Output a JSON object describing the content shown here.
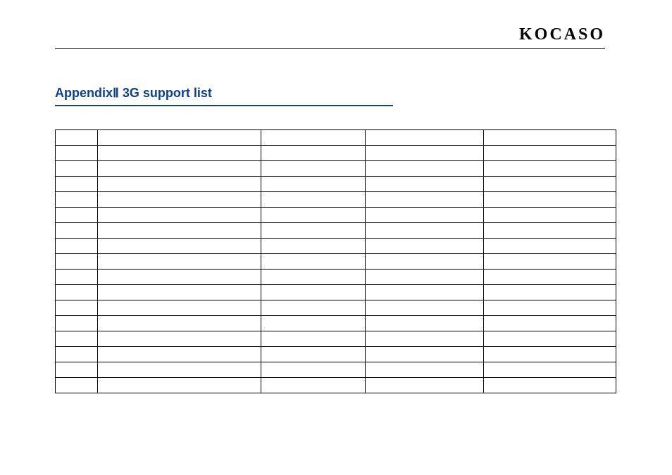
{
  "brand": "KOCASO",
  "title": "AppendixⅡ  3G support list",
  "table": {
    "rows": 17,
    "columns": 5,
    "cells": [
      [
        "",
        "",
        "",
        "",
        ""
      ],
      [
        "",
        "",
        "",
        "",
        ""
      ],
      [
        "",
        "",
        "",
        "",
        ""
      ],
      [
        "",
        "",
        "",
        "",
        ""
      ],
      [
        "",
        "",
        "",
        "",
        ""
      ],
      [
        "",
        "",
        "",
        "",
        ""
      ],
      [
        "",
        "",
        "",
        "",
        ""
      ],
      [
        "",
        "",
        "",
        "",
        ""
      ],
      [
        "",
        "",
        "",
        "",
        ""
      ],
      [
        "",
        "",
        "",
        "",
        ""
      ],
      [
        "",
        "",
        "",
        "",
        ""
      ],
      [
        "",
        "",
        "",
        "",
        ""
      ],
      [
        "",
        "",
        "",
        "",
        ""
      ],
      [
        "",
        "",
        "",
        "",
        ""
      ],
      [
        "",
        "",
        "",
        "",
        ""
      ],
      [
        "",
        "",
        "",
        "",
        ""
      ],
      [
        "",
        "",
        "",
        "",
        ""
      ]
    ]
  }
}
